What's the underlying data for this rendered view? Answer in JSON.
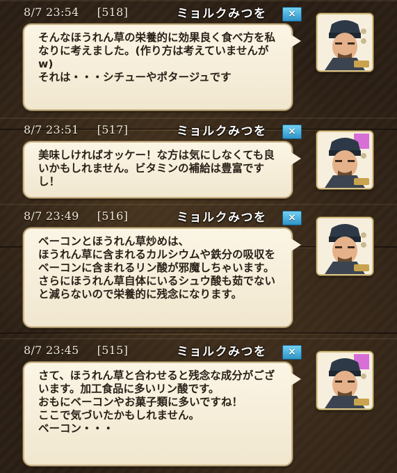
{
  "messages": [
    {
      "datetime": "8/7  23:54",
      "number": "[518]",
      "author": "ミョルクみつを",
      "close_label": "×",
      "text": "そんなほうれん草の栄養的に効果良く食べ方を私なりに考えました。(作り方は考えていませんがw)\nそれは・・・シチューやポタージュです"
    },
    {
      "datetime": "8/7  23:51",
      "number": "[517]",
      "author": "ミョルクみつを",
      "close_label": "×",
      "text": "美味しければオッケー！な方は気にしなくても良いかもしれません。ビタミンの補給は豊富ですし！"
    },
    {
      "datetime": "8/7  23:49",
      "number": "[516]",
      "author": "ミョルクみつを",
      "close_label": "×",
      "text": "ベーコンとほうれん草炒めは、\nほうれん草に含まれるカルシウムや鉄分の吸収をベーコンに含まれるリン酸が邪魔しちゃいます。さらにほうれん草自体にいるシュウ酸も茹でないと減らないので栄養的に残念になります。"
    },
    {
      "datetime": "8/7  23:45",
      "number": "[515]",
      "author": "ミョルクみつを",
      "close_label": "×",
      "text": "さて、ほうれん草と合わせると残念な成分がございます。加工食品に多いリン酸です。\nおもにベーコンやお菓子類に多いですね！\nここで気づいたかもしれません。\nベーコン・・・"
    }
  ],
  "colors": {
    "background": "#2b1f15",
    "bubble": "#f8f0dd",
    "close_button": "#3fa7d6"
  },
  "icons": {
    "close": "close-icon",
    "avatar": "avatar"
  }
}
